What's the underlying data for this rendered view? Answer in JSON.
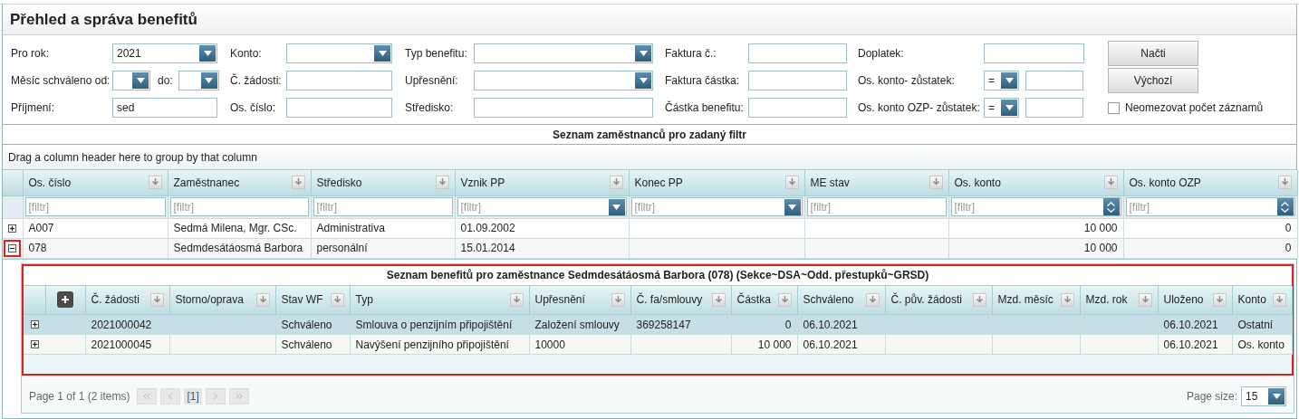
{
  "title": "Přehled a správa benefitů",
  "filter_form": {
    "rows": [
      {
        "cells": [
          {
            "items": [
              {
                "kind": "label",
                "text": "Pro rok:"
              },
              {
                "kind": "select",
                "value": "2021"
              }
            ]
          },
          {
            "items": [
              {
                "kind": "label",
                "text": "Konto:"
              },
              {
                "kind": "select"
              }
            ]
          },
          {
            "items": [
              {
                "kind": "label",
                "text": "Typ benefitu:"
              },
              {
                "kind": "select"
              }
            ]
          },
          {
            "items": [
              {
                "kind": "label",
                "text": "Faktura č.:"
              },
              {
                "kind": "text"
              }
            ]
          },
          {
            "items": [
              {
                "kind": "label",
                "text": "Doplatek:"
              },
              {
                "kind": "text"
              }
            ]
          },
          {
            "items": [
              {
                "kind": "button",
                "text": "Načti"
              }
            ]
          }
        ]
      },
      {
        "cells": [
          {
            "items": [
              {
                "kind": "label",
                "text": "Měsíc schváleno od:"
              },
              {
                "kind": "select"
              },
              {
                "kind": "label",
                "text": "do:"
              },
              {
                "kind": "select"
              }
            ]
          },
          {
            "items": [
              {
                "kind": "label",
                "text": "Č. žádosti:"
              },
              {
                "kind": "text"
              }
            ]
          },
          {
            "items": [
              {
                "kind": "label",
                "text": "Upřesnění:"
              },
              {
                "kind": "select"
              }
            ]
          },
          {
            "items": [
              {
                "kind": "label",
                "text": "Faktura částka:"
              },
              {
                "kind": "text"
              }
            ]
          },
          {
            "items": [
              {
                "kind": "label",
                "text": "Os. konto- zůstatek:"
              },
              {
                "kind": "operator",
                "value": "="
              },
              {
                "kind": "text"
              }
            ]
          },
          {
            "items": [
              {
                "kind": "button",
                "text": "Výchozí"
              }
            ]
          }
        ]
      },
      {
        "cells": [
          {
            "items": [
              {
                "kind": "label",
                "text": "Příjmení:"
              },
              {
                "kind": "text",
                "value": "sed"
              }
            ]
          },
          {
            "items": [
              {
                "kind": "label",
                "text": "Os. číslo:"
              },
              {
                "kind": "text"
              }
            ]
          },
          {
            "items": [
              {
                "kind": "label",
                "text": "Středisko:"
              },
              {
                "kind": "text"
              }
            ]
          },
          {
            "items": [
              {
                "kind": "label",
                "text": "Částka benefitu:"
              },
              {
                "kind": "text"
              }
            ]
          },
          {
            "items": [
              {
                "kind": "label",
                "text": "Os. konto OZP- zůstatek:"
              },
              {
                "kind": "operator",
                "value": "="
              },
              {
                "kind": "text"
              }
            ]
          },
          {
            "items": [
              {
                "kind": "checkbox",
                "text": "Neomezovat počet záznamů",
                "checked": false
              }
            ]
          }
        ]
      }
    ]
  },
  "employees": {
    "title": "Seznam zaměstnanců pro zadaný filtr",
    "group_hint": "Drag a column header here to group by that column",
    "columns": [
      {
        "label": "Os. číslo",
        "kind": "text",
        "placeholder": "[filtr]"
      },
      {
        "label": "Zaměstnanec",
        "kind": "text",
        "placeholder": "[filtr]"
      },
      {
        "label": "Středisko",
        "kind": "text",
        "placeholder": "[filtr]"
      },
      {
        "label": "Vznik PP",
        "kind": "date",
        "placeholder": "[filtr]"
      },
      {
        "label": "Konec PP",
        "kind": "date",
        "placeholder": "[filtr]"
      },
      {
        "label": "ME stav",
        "kind": "text",
        "placeholder": "[filtr]"
      },
      {
        "label": "Os. konto",
        "kind": "number",
        "placeholder": "[filtr]"
      },
      {
        "label": "Os. konto OZP",
        "kind": "number",
        "placeholder": "[filtr]"
      }
    ],
    "rows": [
      {
        "expanded": false,
        "marked": false,
        "cells": [
          "A007",
          "Sedmá Milena, Mgr. CSc.",
          "Administrativa",
          "01.09.2002",
          null,
          null,
          "10 000",
          "0"
        ]
      },
      {
        "expanded": true,
        "marked": true,
        "cells": [
          "078",
          "Sedmdesátáosmá Barbora",
          "personální",
          "15.01.2014",
          null,
          null,
          "10 000",
          "0"
        ]
      }
    ]
  },
  "detail": {
    "title": "Seznam benefitů pro zaměstnance Sedmdesátáosmá Barbora (078) (Sekce~DSA~Odd. přestupků~GRSD)",
    "marked": true,
    "columns": [
      {
        "label": "Č. žádosti",
        "kind": "text"
      },
      {
        "label": "Storno/oprava",
        "kind": "text"
      },
      {
        "label": "Stav WF",
        "kind": "text"
      },
      {
        "label": "Typ",
        "kind": "text"
      },
      {
        "label": "Upřesnění",
        "kind": "text"
      },
      {
        "label": "Č. fa/smlouvy",
        "kind": "text"
      },
      {
        "label": "Částka",
        "kind": "number"
      },
      {
        "label": "Schváleno",
        "kind": "text"
      },
      {
        "label": "Č. pův. žádosti",
        "kind": "text"
      },
      {
        "label": "Mzd. měsíc",
        "kind": "text"
      },
      {
        "label": "Mzd. rok",
        "kind": "text"
      },
      {
        "label": "Uloženo",
        "kind": "text"
      },
      {
        "label": "Konto",
        "kind": "text"
      }
    ],
    "rows": [
      {
        "selected": true,
        "expanded": false,
        "cells": [
          "2021000042",
          null,
          "Schváleno",
          "Smlouva o penzijním připojištění",
          "Založení smlouvy",
          "369258147",
          "0",
          "06.10.2021",
          null,
          null,
          null,
          "06.10.2021",
          "Ostatní"
        ]
      },
      {
        "selected": false,
        "expanded": false,
        "cells": [
          "2021000045",
          null,
          "Schváleno",
          "Navýšení penzijního připojištění",
          "10000",
          null,
          "10 000",
          "06.10.2021",
          null,
          null,
          null,
          "06.10.2021",
          "Os. konto"
        ]
      }
    ],
    "pager": {
      "summary": "Page 1 of 1 (2 items)",
      "nav_before": [
        {
          "kind": "first",
          "disabled": true
        },
        {
          "kind": "prev",
          "disabled": true
        }
      ],
      "current_page": "[1]",
      "nav_after": [
        {
          "kind": "next",
          "disabled": true
        },
        {
          "kind": "last",
          "disabled": true
        }
      ],
      "page_size_label": "Page size:",
      "page_size": "15"
    }
  }
}
